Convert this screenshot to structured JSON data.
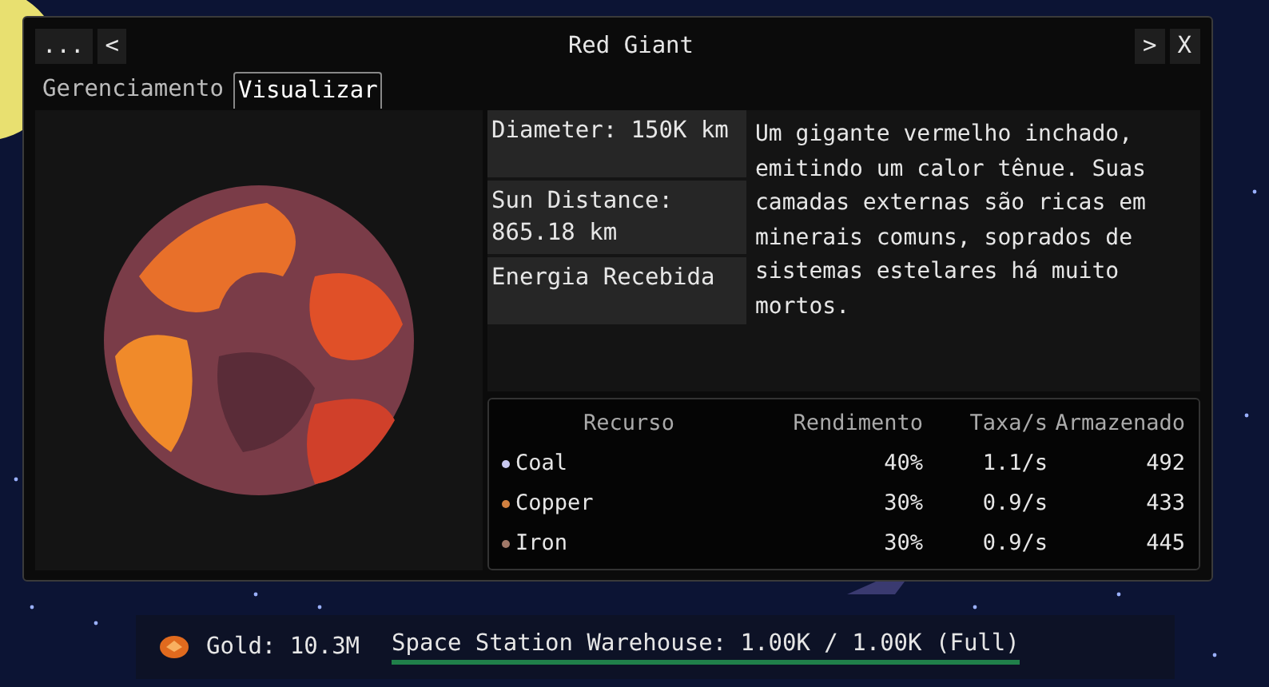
{
  "window": {
    "title": "Red Giant",
    "menu_button": "...",
    "prev_button": "<",
    "next_button": ">",
    "close_button": "X"
  },
  "tabs": [
    {
      "label": "Gerenciamento",
      "selected": false
    },
    {
      "label": "Visualizar",
      "selected": true
    }
  ],
  "stats": [
    "Diameter: 150K km",
    "Sun Distance: 865.18 km",
    "Energia Recebida"
  ],
  "description": "Um gigante vermelho inchado, emitindo um calor tênue. Suas camadas externas são ricas em minerais comuns, soprados de sistemas estelares há muito mortos.",
  "table": {
    "columns": [
      "Recurso",
      "Rendimento",
      "Taxa/s",
      "Armazenado"
    ],
    "rows": [
      {
        "name": "Coal",
        "color": "#c8c8f0",
        "yield": "40%",
        "rate": "1.1/s",
        "stored": "492"
      },
      {
        "name": "Copper",
        "color": "#d08040",
        "yield": "30%",
        "rate": "0.9/s",
        "stored": "433"
      },
      {
        "name": "Iron",
        "color": "#a07868",
        "yield": "30%",
        "rate": "0.9/s",
        "stored": "445"
      }
    ]
  },
  "status_bar": {
    "gold": "Gold: 10.3M",
    "warehouse": "Space Station Warehouse: 1.00K / 1.00K (Full)",
    "level": 1
  }
}
